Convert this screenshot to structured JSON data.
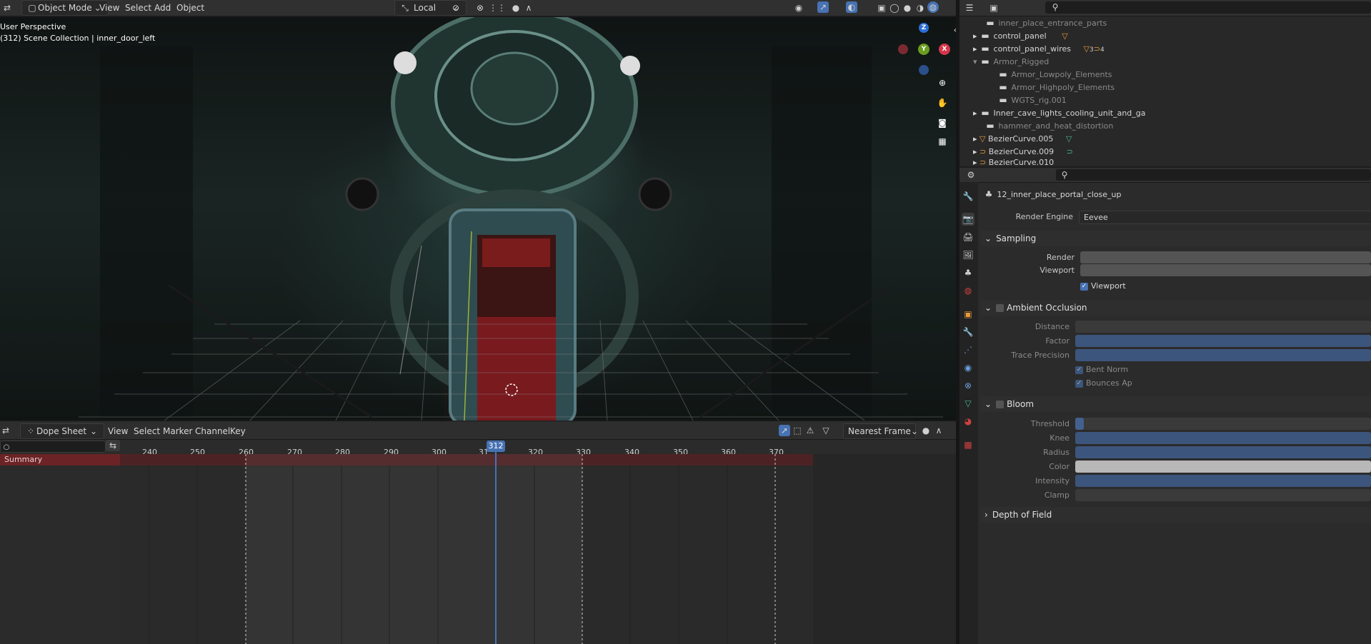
{
  "topbar": {
    "mode": "Object Mode",
    "menus": [
      "View",
      "Select",
      "Add",
      "Object"
    ],
    "transform_orientation": "Local"
  },
  "viewport": {
    "view_name": "User Perspective",
    "collection_info": "(312) Scene Collection | inner_door_left",
    "gizmo": {
      "z": "Z",
      "y": "Y",
      "x": "X"
    }
  },
  "dopesheet": {
    "editor": "Dope Sheet",
    "menus": [
      "View",
      "Select",
      "Marker",
      "Channel",
      "Key"
    ],
    "snap": "Nearest Frame",
    "current_frame": "312",
    "ticks": [
      "240",
      "250",
      "260",
      "270",
      "280",
      "290",
      "300",
      "31",
      "320",
      "330",
      "340",
      "350",
      "360",
      "370"
    ],
    "summary_label": "Summary"
  },
  "outliner": {
    "rows": [
      {
        "label": "inner_place_entrance_parts",
        "dim": true
      },
      {
        "label": "control_panel",
        "dim": false
      },
      {
        "label": "control_panel_wires",
        "dim": false,
        "badge": "3",
        "badge2": "4"
      },
      {
        "label": "Armor_Rigged",
        "dim": true
      },
      {
        "label": "Armor_Lowpoly_Elements",
        "dim": true
      },
      {
        "label": "Armor_Highpoly_Elements",
        "dim": true
      },
      {
        "label": "WGTS_rig.001",
        "dim": true
      },
      {
        "label": "Inner_cave_lights_cooling_unit_and_ga",
        "dim": false
      },
      {
        "label": "hammer_and_heat_distortion",
        "dim": true
      },
      {
        "label": "BezierCurve.005",
        "dim": false
      },
      {
        "label": "BezierCurve.009",
        "dim": false
      },
      {
        "label": "BezierCurve.010",
        "dim": false
      }
    ]
  },
  "properties": {
    "scene_name": "12_inner_place_portal_close_up",
    "render_engine_label": "Render Engine",
    "render_engine": "Eevee",
    "sampling": {
      "title": "Sampling",
      "render_label": "Render",
      "viewport_label": "Viewport",
      "viewport_denoise": "Viewport"
    },
    "ao": {
      "title": "Ambient Occlusion",
      "distance": "Distance",
      "factor": "Factor",
      "trace": "Trace Precision",
      "bent": "Bent Norm",
      "bounces": "Bounces Ap"
    },
    "bloom": {
      "title": "Bloom",
      "threshold": "Threshold",
      "knee": "Knee",
      "radius": "Radius",
      "color": "Color",
      "intensity": "Intensity",
      "clamp": "Clamp"
    },
    "dof": {
      "title": "Depth of Field"
    }
  },
  "colors": {
    "accent": "#4772b3",
    "summary": "#6b2326",
    "playhead": "#4772b3"
  }
}
